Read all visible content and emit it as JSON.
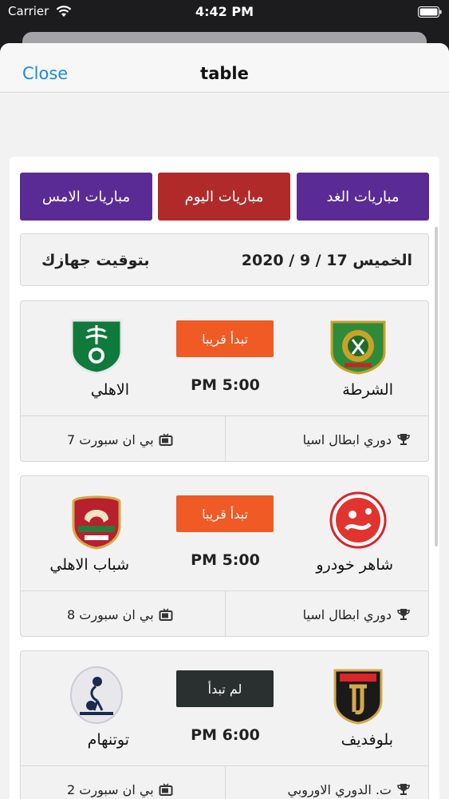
{
  "status_bar": {
    "carrier": "Carrier",
    "time": "4:42 PM"
  },
  "nav": {
    "close_label": "Close",
    "title": "table"
  },
  "tabs": {
    "tomorrow": "مباريات الغد",
    "today": "مباريات اليوم",
    "yesterday": "مباريات الامس"
  },
  "date_bar": {
    "date": "الخميس 17 / 9 / 2020",
    "timezone": "بتوقيت جهازك"
  },
  "colors": {
    "tab_purple": "#5a2b95",
    "tab_red": "#b02a2a",
    "badge_orange": "#ef5a25",
    "badge_dark": "#2a2f30",
    "link_blue": "#1a8be0"
  },
  "matches": [
    {
      "home_team": "الشرطة",
      "away_team": "الاهلي",
      "status": "تبدأ قريبا",
      "time": "PM 5:00",
      "league": "دوري ابطال اسيا",
      "channel": "بي ان سبورت 7"
    },
    {
      "home_team": "شاهر خودرو",
      "away_team": "شباب الاهلي",
      "status": "تبدأ قريبا",
      "time": "PM 5:00",
      "league": "دوري ابطال اسيا",
      "channel": "بي ان سبورت 8"
    },
    {
      "home_team": "بلوفديف",
      "away_team": "توتنهام",
      "status": "لم تبدأ",
      "time": "PM 6:00",
      "league": "ت. الدوري الاوروبي",
      "channel": "بي ان سبورت 2"
    }
  ]
}
